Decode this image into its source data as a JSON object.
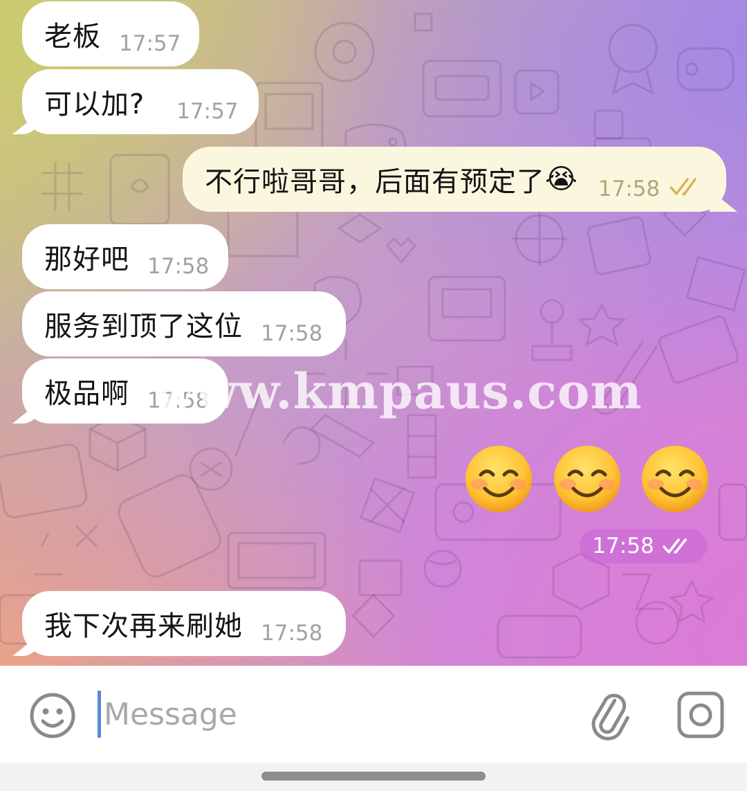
{
  "messages": [
    {
      "text": "老板",
      "time": "17:57"
    },
    {
      "text": "可以加?",
      "time": "17:57"
    },
    {
      "text": "不行啦哥哥，后面有预定了",
      "emoji": "😭",
      "time": "17:58"
    },
    {
      "text": "那好吧",
      "time": "17:58"
    },
    {
      "text": "服务到顶了这位",
      "time": "17:58"
    },
    {
      "text": "极品啊",
      "time": "17:58"
    },
    {
      "text": "😊 😊 😊",
      "time": "17:58"
    },
    {
      "text": "我下次再来刷她",
      "time": "17:58"
    }
  ],
  "watermark": "www.kmpaus.com",
  "composer": {
    "placeholder": "Message"
  },
  "icons": {
    "emoji_button": "smiley-face-icon",
    "attach_button": "paperclip-icon",
    "camera_button": "camera-icon",
    "read_status": "double-check-icon"
  },
  "colors": {
    "incoming_bubble": "#ffffff",
    "outgoing_bubble": "#fbf7df",
    "read_check_outgoing": "#d8b35a",
    "cursor": "#5b87d6"
  }
}
